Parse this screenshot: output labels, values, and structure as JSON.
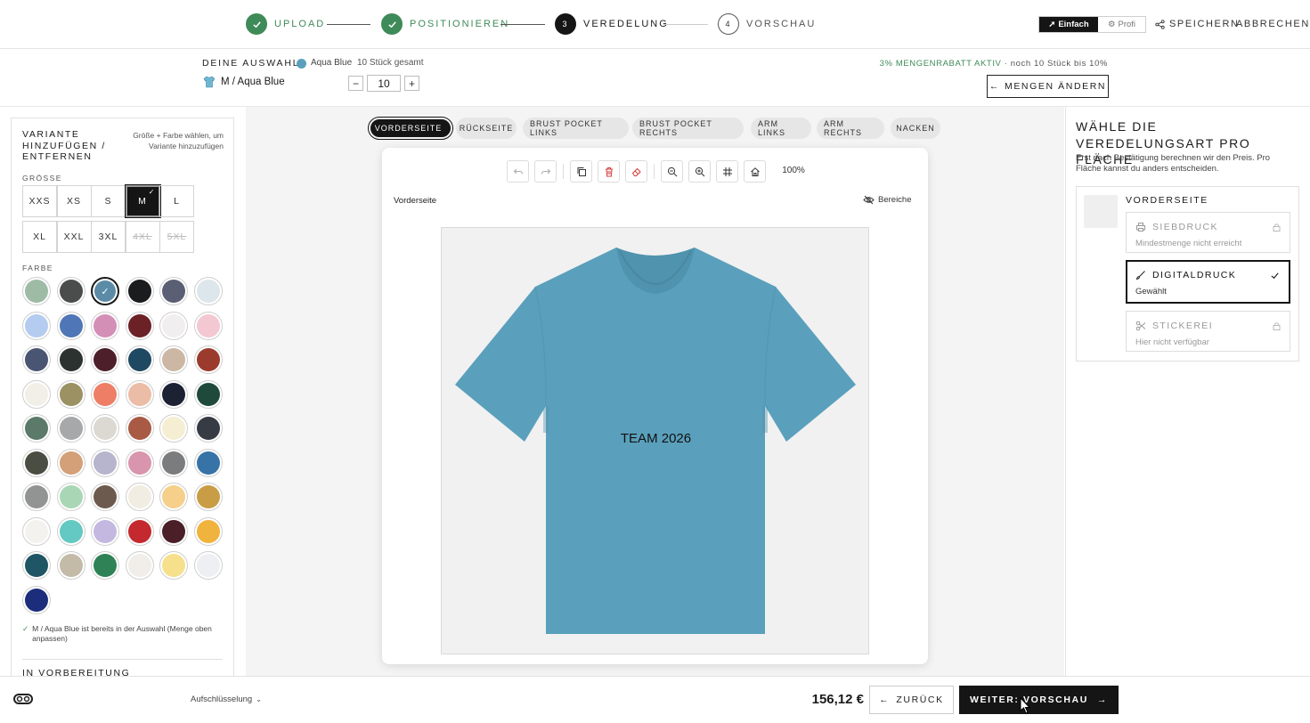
{
  "stepper": {
    "steps": [
      {
        "label": "UPLOAD",
        "state": "done",
        "marker": "✓"
      },
      {
        "label": "POSITIONIEREN",
        "state": "done",
        "marker": "✓"
      },
      {
        "label": "VEREDELUNG",
        "state": "active",
        "marker": "3"
      },
      {
        "label": "VORSCHAU",
        "state": "todo",
        "marker": "4"
      }
    ],
    "mode_simple": "Einfach",
    "mode_pro": "Profi",
    "save": "SPEICHERN",
    "cancel": "ABBRECHEN"
  },
  "selection": {
    "caption": "DEINE AUSWAHL",
    "color_name": "Aqua Blue",
    "total": "10 Stück gesamt",
    "variant": "M / Aqua Blue",
    "quantity": "10",
    "minus": "−",
    "plus": "+",
    "discount_active": "3% MENGENRABATT AKTIV",
    "discount_hint": "· noch 10 Stück bis 10%",
    "change_amounts": "MENGEN ÄNDERN"
  },
  "variant_panel": {
    "title": "VARIANTE HINZUFÜGEN / ENTFERNEN",
    "hint": "Größe + Farbe wählen, um Variante hinzuzufügen",
    "size_caption": "GRÖSSE",
    "sizes": [
      {
        "label": "XXS",
        "state": "normal"
      },
      {
        "label": "XS",
        "state": "normal"
      },
      {
        "label": "S",
        "state": "normal"
      },
      {
        "label": "M",
        "state": "selected"
      },
      {
        "label": "L",
        "state": "normal"
      },
      {
        "label": "XL",
        "state": "normal"
      },
      {
        "label": "XXL",
        "state": "normal"
      },
      {
        "label": "3XL",
        "state": "normal"
      },
      {
        "label": "4XL",
        "state": "disabled"
      },
      {
        "label": "5XL",
        "state": "disabled"
      }
    ],
    "color_caption": "FARBE",
    "colors": [
      "#9dbba5",
      "#4a4d4c",
      "#5b8ba6",
      "#1a1c1d",
      "#5a5f73",
      "#dde6ea",
      "#b4ccef",
      "#4f76b6",
      "#d48fb7",
      "#6c2127",
      "#f0eeee",
      "#f3c8d3",
      "#4a5573",
      "#2c3230",
      "#4d1f2a",
      "#1f4862",
      "#cbb7a3",
      "#9a3b2e",
      "#f1efe8",
      "#9b9163",
      "#ef7e66",
      "#ebbca6",
      "#1c2234",
      "#1f4a3b",
      "#5b7a6a",
      "#a6a8aa",
      "#dcd8d2",
      "#a85a45",
      "#f5eed2",
      "#363b44",
      "#4a4d42",
      "#d3a078",
      "#b6b5cd",
      "#d995ad",
      "#7b7c7d",
      "#3773a6",
      "#929493",
      "#a9d7b6",
      "#6c5a4e",
      "#f2ede2",
      "#f6cf8b",
      "#c89d45",
      "#f4f2ef",
      "#63c9c2",
      "#c4b8e0",
      "#c4292f",
      "#4a1f28",
      "#f0b33d",
      "#1f5564",
      "#c3bba8",
      "#2f8255",
      "#f1eeea",
      "#f7e08c",
      "#eeeff2",
      "#1c2d7c"
    ],
    "selected_color_index": 2,
    "notice": "M / Aqua Blue ist bereits in der Auswahl (Menge oben anpassen)",
    "next_section": "IN VORBEREITUNG"
  },
  "placements": {
    "tabs": [
      {
        "label": "VORDERSEITE",
        "active": true
      },
      {
        "label": "RÜCKSEITE",
        "active": false
      },
      {
        "label": "BRUST POCKET LINKS",
        "active": false
      },
      {
        "label": "BRUST POCKET RECHTS",
        "active": false
      },
      {
        "label": "ARM LINKS",
        "active": false
      },
      {
        "label": "ARM RECHTS",
        "active": false
      },
      {
        "label": "NACKEN",
        "active": false
      }
    ]
  },
  "editor": {
    "zoom": "100%",
    "side_label": "Vorderseite",
    "areas_label": "Bereiche",
    "shirt_color": "#5aa0bc",
    "print_text": "TEAM 2026"
  },
  "finishing": {
    "title": "WÄHLE DIE VEREDELUNGSART PRO FLÄCHE",
    "subtitle": "Erst nach Bestätigung berechnen wir den Preis. Pro Fläche kannst du anders entscheiden.",
    "area": "VORDERSEITE",
    "options": [
      {
        "title": "SIEBDRUCK",
        "sub": "Mindestmenge nicht erreicht",
        "state": "locked"
      },
      {
        "title": "DIGITALDRUCK",
        "sub": "Gewählt",
        "state": "selected"
      },
      {
        "title": "STICKEREI",
        "sub": "Hier nicht verfügbar",
        "state": "locked"
      }
    ]
  },
  "footer": {
    "breakdown": "Aufschlüsselung",
    "price": "156,12 €",
    "back": "ZURÜCK",
    "next": "WEITER: VORSCHAU"
  }
}
